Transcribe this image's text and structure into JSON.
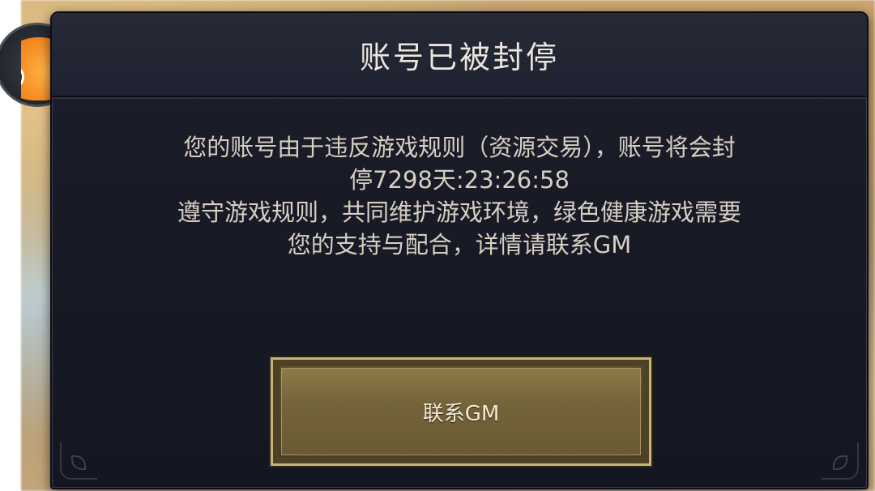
{
  "dialog": {
    "title": "账号已被封停",
    "message_lines": [
      "您的账号由于违反游戏规则（资源交易），账号将会封",
      "停7298天:23:26:58",
      "遵守游戏规则，共同维护游戏环境，绿色健康游戏需要",
      "您的支持与配合，详情请联系GM"
    ],
    "contact_button_label": "联系GM"
  },
  "colors": {
    "dialog_background": "#181a26",
    "title_text": "#ece7dd",
    "message_text": "#d8cfc2",
    "button_gold": "#7d6b3e",
    "button_border": "#c8b478"
  },
  "icons": {
    "avatar": "orange-mascot-avatar"
  }
}
